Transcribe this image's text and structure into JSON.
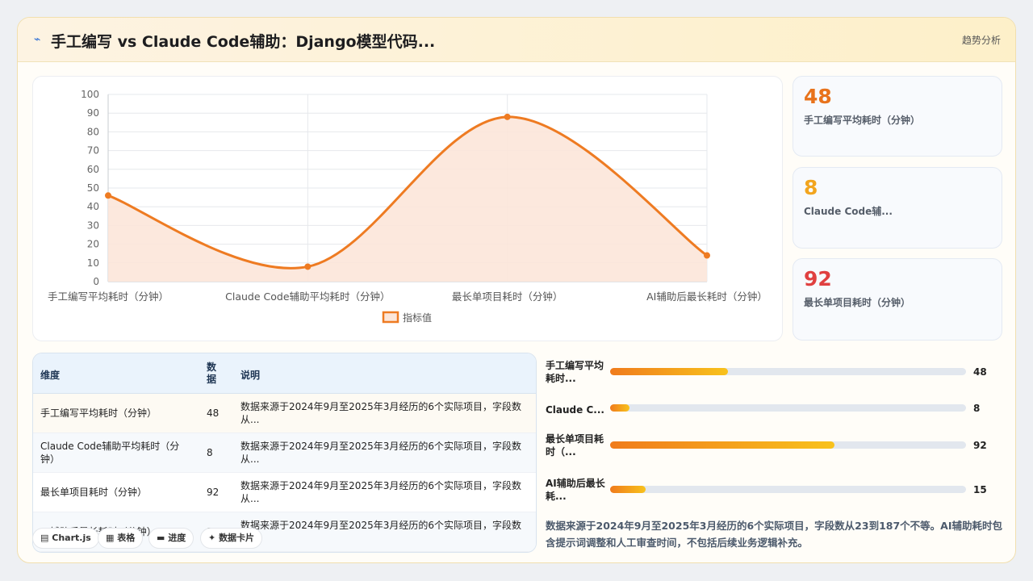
{
  "header": {
    "icon": "chart-line-icon",
    "title": "手工编写 vs Claude Code辅助：Django模型代码...",
    "right_label": "趋势分析"
  },
  "chart_data": {
    "type": "area",
    "categories": [
      "手工编写平均耗时（分钟）",
      "Claude Code辅助平均耗时（分钟）",
      "最长单项目耗时（分钟）",
      "AI辅助后最长耗时（分钟）"
    ],
    "series": [
      {
        "name": "指标值",
        "values": [
          46,
          8,
          88,
          14
        ]
      }
    ],
    "ylim": [
      0,
      100
    ],
    "yticks": [
      0,
      10,
      20,
      30,
      40,
      50,
      60,
      70,
      80,
      90,
      100
    ],
    "line_color": "#ee7b22",
    "fill_color": "#fce6d9",
    "grid": true,
    "legend": "bottom"
  },
  "stats": [
    {
      "value": "48",
      "label": "手工编写平均耗时（分钟）",
      "color": "#e8731c"
    },
    {
      "value": "8",
      "label": "Claude Code辅...",
      "color": "#f2a51e"
    },
    {
      "value": "92",
      "label": "最长单项目耗时（分钟）",
      "color": "#e04040"
    }
  ],
  "table": {
    "headers": {
      "dimension": "维度",
      "data": "数据",
      "desc": "说明"
    },
    "rows": [
      {
        "name": "手工编写平均耗时（分钟）",
        "value": "48",
        "desc": "数据来源于2024年9月至2025年3月经历的6个实际项目，字段数从..."
      },
      {
        "name": "Claude Code辅助平均耗时（分钟）",
        "value": "8",
        "desc": "数据来源于2024年9月至2025年3月经历的6个实际项目，字段数从..."
      },
      {
        "name": "最长单项目耗时（分钟）",
        "value": "92",
        "desc": "数据来源于2024年9月至2025年3月经历的6个实际项目，字段数从..."
      },
      {
        "name": "AI辅助后最长耗时（分钟）",
        "value": "15",
        "desc": "数据来源于2024年9月至2025年3月经历的6个实际项目，字段数从..."
      }
    ]
  },
  "toggles": [
    {
      "icon": "chart-icon",
      "glyph": "▤",
      "label": "Chart.js"
    },
    {
      "icon": "table-icon",
      "glyph": "▦",
      "label": "表格"
    },
    {
      "icon": "progress-icon",
      "glyph": "▬",
      "label": "进度"
    },
    {
      "icon": "card-icon",
      "glyph": "✦",
      "label": "数据卡片"
    }
  ],
  "progress": [
    {
      "label": "手工编写平均耗时...",
      "value": "48",
      "fill": 0.33
    },
    {
      "label": "Claude C...",
      "value": "8",
      "fill": 0.055
    },
    {
      "label": "最长单项目耗时（...",
      "value": "92",
      "fill": 0.63
    },
    {
      "label": "AI辅助后最长耗...",
      "value": "15",
      "fill": 0.1
    }
  ],
  "note": "数据来源于2024年9月至2025年3月经历的6个实际项目，字段数从23到187个不等。AI辅助耗时包含提示词调整和人工审查时间，不包括后续业务逻辑补充。"
}
